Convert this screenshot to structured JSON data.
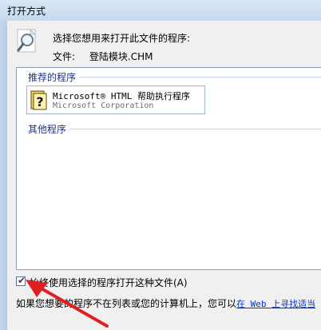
{
  "window": {
    "title": "打开方式"
  },
  "header": {
    "prompt": "选择您想用来打开此文件的程序:",
    "file_label": "文件:",
    "file_name": "登陆模块.CHM"
  },
  "list": {
    "recommended_label": "推荐的程序",
    "other_label": "其他程序",
    "items": [
      {
        "name": "Microsoft® HTML 帮助执行程序",
        "vendor": "Microsoft Corporation"
      }
    ]
  },
  "options": {
    "always_use_label": "始终使用选择的程序打开这种文件(A)",
    "always_use_checked": true
  },
  "footer": {
    "text": "如果您想要的程序不在列表或您的计算机上，您可以",
    "link": "在 Web 上寻找适当"
  },
  "colors": {
    "annotation_arrow": "#e02020",
    "group_text": "#1e3287",
    "link": "#0033cc"
  }
}
